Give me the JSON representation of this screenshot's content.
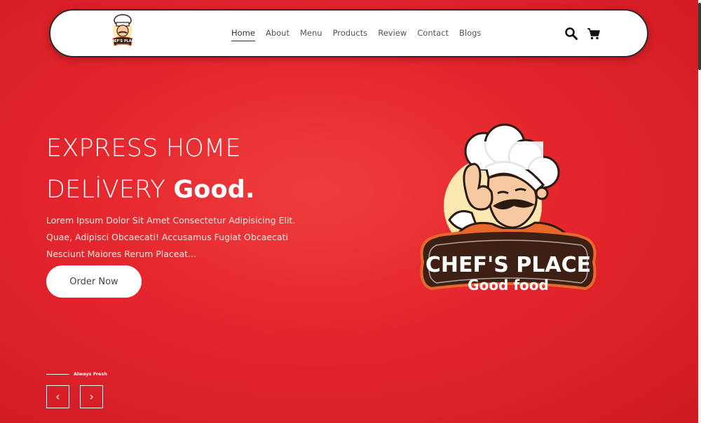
{
  "header": {
    "nav": [
      {
        "label": "Home",
        "active": true
      },
      {
        "label": "About"
      },
      {
        "label": "Menu"
      },
      {
        "label": "Products"
      },
      {
        "label": "Review"
      },
      {
        "label": "Contact"
      },
      {
        "label": "Blogs"
      }
    ],
    "icons": [
      "search-icon",
      "cart-icon"
    ]
  },
  "hero": {
    "title_line1": "EXPRESS HOME",
    "title_line2_light": "DELİVERY",
    "title_line2_bold": "Good.",
    "description": "Lorem Ipsum Dolor Sit Amet Consectetur Adipisicing Elit. Quae, Adipisci Obcaecati! Accusamus Fugiat Obcaecati Nesciunt Maiores Rerum Placeat...",
    "cta_label": "Order Now"
  },
  "brand": {
    "name": "CHEF'S PLACE",
    "tagline": "Good food"
  },
  "slider": {
    "label": "Always Fresh",
    "prev_glyph": "‹",
    "next_glyph": "›"
  },
  "colors": {
    "background": "#e4252d",
    "banner": "#3d1f14",
    "chef_jacket": "#e8672b",
    "header_bg": "#ffffff"
  }
}
